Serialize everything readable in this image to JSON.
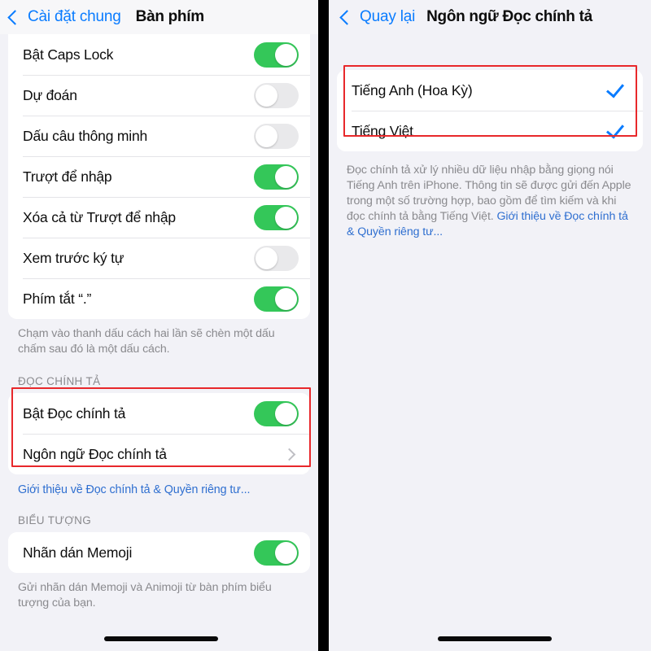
{
  "left_panel": {
    "nav": {
      "back_label": "Cài đặt chung",
      "title": "Bàn phím",
      "back_icon": "chevron-left-icon"
    },
    "keyboard_rows": [
      {
        "label": "Bật Caps Lock",
        "toggle": "on"
      },
      {
        "label": "Dự đoán",
        "toggle": "off"
      },
      {
        "label": "Dấu câu thông minh",
        "toggle": "off"
      },
      {
        "label": "Trượt để nhập",
        "toggle": "on"
      },
      {
        "label": "Xóa cả từ Trượt để nhập",
        "toggle": "on"
      },
      {
        "label": "Xem trước ký tự",
        "toggle": "off"
      },
      {
        "label": "Phím tắt “.”",
        "toggle": "on"
      }
    ],
    "keyboard_footnote": "Chạm vào thanh dấu cách hai lần sẽ chèn một dấu chấm sau đó là một dấu cách.",
    "dictation_header": "ĐỌC CHÍNH TẢ",
    "dictation_rows": [
      {
        "label": "Bật Đọc chính tả",
        "type": "toggle",
        "toggle": "on"
      },
      {
        "label": "Ngôn ngữ Đọc chính tả",
        "type": "disclosure",
        "accessory_icon": "chevron-right-icon"
      }
    ],
    "dictation_link": "Giới thiệu về Đọc chính tả & Quyền riêng tư...",
    "emoji_header": "BIỂU TƯỢNG",
    "emoji_rows": [
      {
        "label": "Nhãn dán Memoji",
        "toggle": "on"
      }
    ],
    "emoji_footnote": "Gửi nhãn dán Memoji và Animoji từ bàn phím biểu tượng của bạn."
  },
  "right_panel": {
    "nav": {
      "back_label": "Quay lại",
      "title": "Ngôn ngữ Đọc chính tả",
      "back_icon": "chevron-left-icon"
    },
    "language_rows": [
      {
        "label": "Tiếng Anh (Hoa Kỳ)",
        "selected": true,
        "accessory_icon": "checkmark-icon"
      },
      {
        "label": "Tiếng Việt",
        "selected": true,
        "accessory_icon": "checkmark-icon"
      }
    ],
    "footnote_text": "Đọc chính tả xử lý nhiều dữ liệu nhập bằng giọng nói Tiếng Anh trên iPhone. Thông tin sẽ được gửi đến Apple trong một số trường hợp, bao gồm để tìm kiếm và khi đọc chính tả bằng Tiếng Việt. ",
    "footnote_link": "Giới thiệu về Đọc chính tả & Quyền riêng tư..."
  },
  "colors": {
    "toggle_on": "#34C759",
    "toggle_off": "#E9E9EB",
    "accent_blue": "#0A7CFF",
    "link_blue": "#2F6FD0",
    "annotation_red": "#E8282B",
    "page_background": "#F2F2F7",
    "card_background": "#FFFFFF"
  }
}
